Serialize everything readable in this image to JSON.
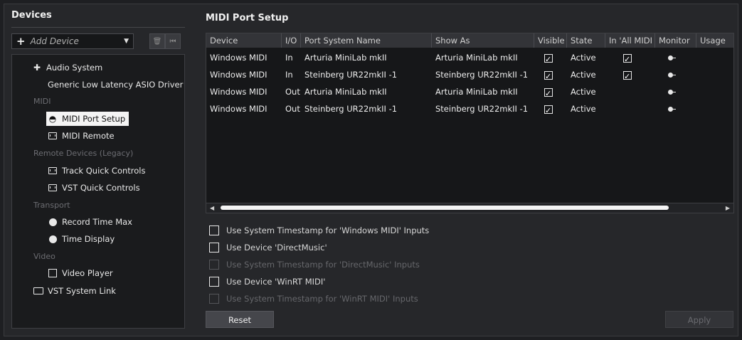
{
  "devices_panel": {
    "title": "Devices",
    "add_device_label": "Add Device",
    "items": [
      {
        "type": "item",
        "label": "Audio System",
        "icon": "audio-system-icon"
      },
      {
        "type": "item",
        "label": "Generic Low Latency ASIO Driver"
      },
      {
        "type": "header",
        "label": "MIDI"
      },
      {
        "type": "item",
        "label": "MIDI Port Setup",
        "icon": "midi-port-icon",
        "selected": true
      },
      {
        "type": "item",
        "label": "MIDI Remote",
        "icon": "keyboard-icon"
      },
      {
        "type": "header",
        "label": "Remote Devices (Legacy)"
      },
      {
        "type": "item",
        "label": "Track Quick Controls",
        "icon": "keyboard-icon"
      },
      {
        "type": "item",
        "label": "VST Quick Controls",
        "icon": "keyboard-icon"
      },
      {
        "type": "header",
        "label": "Transport"
      },
      {
        "type": "item",
        "label": "Record Time Max",
        "icon": "clock-icon"
      },
      {
        "type": "item",
        "label": "Time Display",
        "icon": "clock-icon"
      },
      {
        "type": "header",
        "label": "Video"
      },
      {
        "type": "item",
        "label": "Video Player",
        "icon": "video-player-icon"
      },
      {
        "type": "item",
        "label": "VST System Link",
        "icon": "monitor-icon"
      }
    ]
  },
  "midi_port_setup": {
    "title": "MIDI Port Setup",
    "columns": [
      "Device",
      "I/O",
      "Port System Name",
      "Show As",
      "Visible",
      "State",
      "In 'All MIDI Inputs'",
      "Monitor",
      "Usage"
    ],
    "rows": [
      {
        "device": "Windows MIDI",
        "io": "In",
        "port": "Arturia MiniLab mkII",
        "show_as": "Arturia MiniLab mkII",
        "visible": true,
        "state": "Active",
        "in_all": true
      },
      {
        "device": "Windows MIDI",
        "io": "In",
        "port": "Steinberg UR22mkII -1",
        "show_as": "Steinberg UR22mkII -1",
        "visible": true,
        "state": "Active",
        "in_all": true
      },
      {
        "device": "Windows MIDI",
        "io": "Out",
        "port": "Arturia MiniLab mkII",
        "show_as": "Arturia MiniLab mkII",
        "visible": true,
        "state": "Active",
        "in_all": false
      },
      {
        "device": "Windows MIDI",
        "io": "Out",
        "port": "Steinberg UR22mkII -1",
        "show_as": "Steinberg UR22mkII -1",
        "visible": true,
        "state": "Active",
        "in_all": false
      }
    ],
    "options": [
      {
        "label": "Use System Timestamp for 'Windows MIDI' Inputs",
        "checked": false,
        "enabled": true
      },
      {
        "label": "Use Device 'DirectMusic'",
        "checked": false,
        "enabled": true
      },
      {
        "label": "Use System Timestamp for 'DirectMusic' Inputs",
        "checked": false,
        "enabled": false
      },
      {
        "label": "Use Device 'WinRT MIDI'",
        "checked": false,
        "enabled": true
      },
      {
        "label": "Use System Timestamp for 'WinRT MIDI' Inputs",
        "checked": false,
        "enabled": false
      }
    ],
    "reset_label": "Reset",
    "apply_label": "Apply"
  }
}
